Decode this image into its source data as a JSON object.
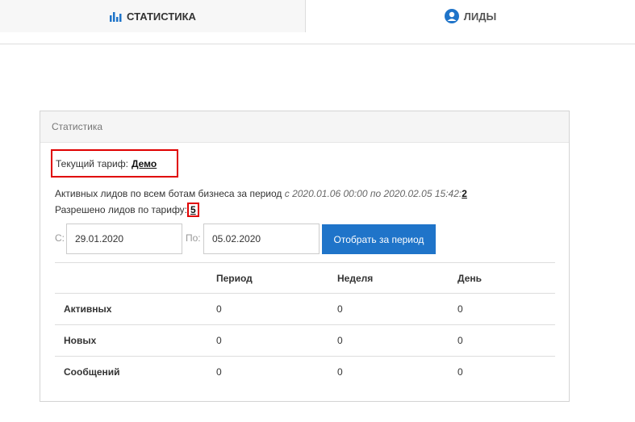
{
  "tabs": [
    {
      "label": "СТАТИСТИКА",
      "icon": "bar-chart-icon",
      "active": true
    },
    {
      "label": "ЛИДЫ",
      "icon": "user-circle-icon",
      "active": false
    }
  ],
  "colors": {
    "accent": "#1f74c9",
    "highlight": "#e00000"
  },
  "panel": {
    "heading": "Статистика",
    "tariff_label": "Текущий тариф:",
    "tariff_value": "Демо",
    "active_leads_text": "Активных лидов по всем ботам бизнеса за период",
    "active_leads_period": "с 2020.01.06 00:00 по 2020.02.05 15:42:",
    "active_leads_count": "2",
    "allowed_leads_text": "Разрешено лидов по тарифу:",
    "allowed_leads_count": "5"
  },
  "filter": {
    "from_label": "С:",
    "from_value": "29.01.2020",
    "to_label": "По:",
    "to_value": "05.02.2020",
    "button_label": "Отобрать за период"
  },
  "table": {
    "headers": [
      "",
      "Период",
      "Неделя",
      "День"
    ],
    "rows": [
      {
        "label": "Активных",
        "values": [
          "0",
          "0",
          "0"
        ]
      },
      {
        "label": "Новых",
        "values": [
          "0",
          "0",
          "0"
        ]
      },
      {
        "label": "Сообщений",
        "values": [
          "0",
          "0",
          "0"
        ]
      }
    ]
  }
}
